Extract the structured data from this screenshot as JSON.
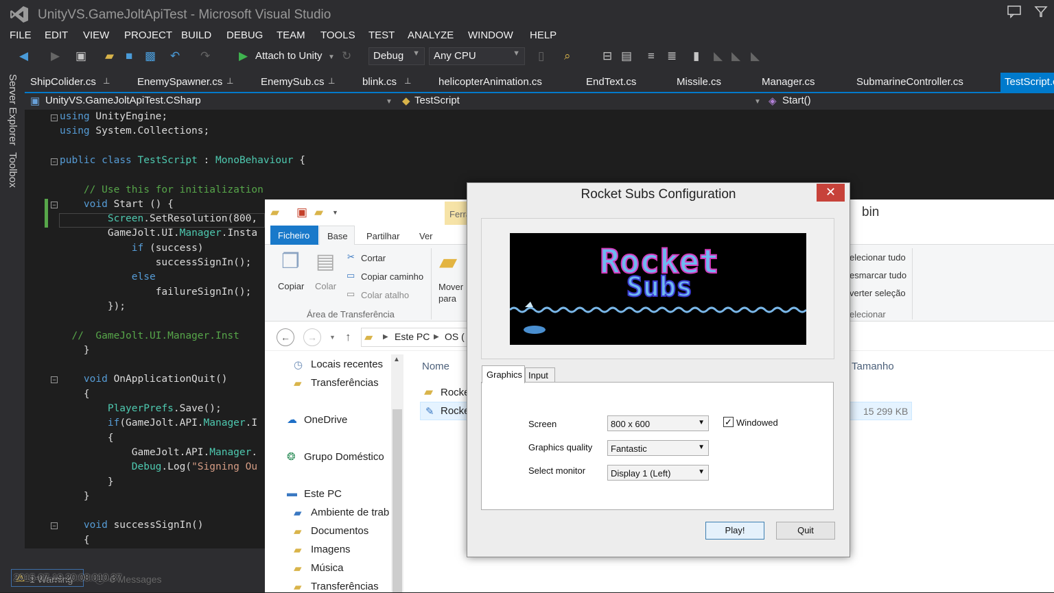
{
  "vs": {
    "title": "UnityVS.GameJoltApiTest - Microsoft Visual Studio",
    "menu": [
      "FILE",
      "EDIT",
      "VIEW",
      "PROJECT",
      "BUILD",
      "DEBUG",
      "TEAM",
      "TOOLS",
      "TEST",
      "ANALYZE",
      "WINDOW",
      "HELP"
    ],
    "toolbar": {
      "attach_label": "Attach to Unity",
      "config": "Debug",
      "platform": "Any CPU"
    },
    "side_panels": [
      "Server Explorer",
      "Toolbox"
    ],
    "tabs": [
      "ShipColider.cs",
      "EnemySpawner.cs",
      "EnemySub.cs",
      "blink.cs",
      "helicopterAnimation.cs",
      "EndText.cs",
      "Missile.cs",
      "Manager.cs",
      "SubmarineController.cs",
      "TestScript.cs"
    ],
    "nav": {
      "project": "UnityVS.GameJoltApiTest.CSharp",
      "class": "TestScript",
      "member": "Start()"
    },
    "code": [
      "using UnityEngine;",
      "using System.Collections;",
      "",
      "public class TestScript : MonoBehaviour {",
      "",
      "    // Use this for initialization",
      "    void Start () {",
      "        Screen.SetResolution(800,",
      "        GameJolt.UI.Manager.Insta",
      "            if (success)",
      "                successSignIn();",
      "            else",
      "                failureSignIn();",
      "        });",
      "",
      "  //  GameJolt.UI.Manager.Inst",
      "    }",
      "",
      "    void OnApplicationQuit()",
      "    {",
      "        PlayerPrefs.Save();",
      "        if(GameJolt.API.Manager.I",
      "        {",
      "            GameJolt.API.Manager.",
      "            Debug.Log(\"Signing Ou",
      "        }",
      "    }",
      "",
      "    void successSignIn()",
      "    {"
    ],
    "status": {
      "warning": "1 Warning",
      "messages": "0 Messages",
      "timestamp": "2015-07-19 20:08:010.37"
    }
  },
  "explorer": {
    "title": "bin",
    "ribbon_tabs": [
      "Ficheiro",
      "Base",
      "Partilhar",
      "Ver"
    ],
    "context_tab": "Ferra",
    "clipboard": {
      "copy": "Copiar",
      "paste": "Colar",
      "cut": "Cortar",
      "copy_path": "Copiar caminho",
      "paste_shortcut": "Colar atalho",
      "group": "Área de Transferência"
    },
    "move_to": "Mover\npara",
    "select": {
      "select_all": "elecionar tudo",
      "select_none": "esmarcar tudo",
      "invert": "verter seleção",
      "group": "elecionar"
    },
    "address": [
      "Este PC",
      "OS ("
    ],
    "nav_items": [
      "Locais recentes",
      "Transferências",
      "OneDrive",
      "Grupo Doméstico",
      "Este PC",
      "Ambiente de trab",
      "Documentos",
      "Imagens",
      "Música",
      "Transferências"
    ],
    "columns": {
      "name": "Nome",
      "size": "Tamanho"
    },
    "files": [
      {
        "name": "Rocke",
        "size": ""
      },
      {
        "name": "Rocke",
        "size": "15 299 KB"
      }
    ]
  },
  "dialog": {
    "title": "Rocket Subs Configuration",
    "close": "✕",
    "banner_line1": "Rocket",
    "banner_line2": "Subs",
    "tabs": [
      "Graphics",
      "Input"
    ],
    "screen_label": "Screen",
    "screen_value": "800 x 600",
    "windowed_label": "Windowed",
    "windowed_checked": true,
    "quality_label": "Graphics quality",
    "quality_value": "Fantastic",
    "monitor_label": "Select monitor",
    "monitor_value": "Display 1 (Left)",
    "play": "Play!",
    "quit": "Quit"
  },
  "colors": {
    "vs_blue": "#007acc",
    "explorer_blue": "#1979ca",
    "close_red": "#c7423a"
  }
}
